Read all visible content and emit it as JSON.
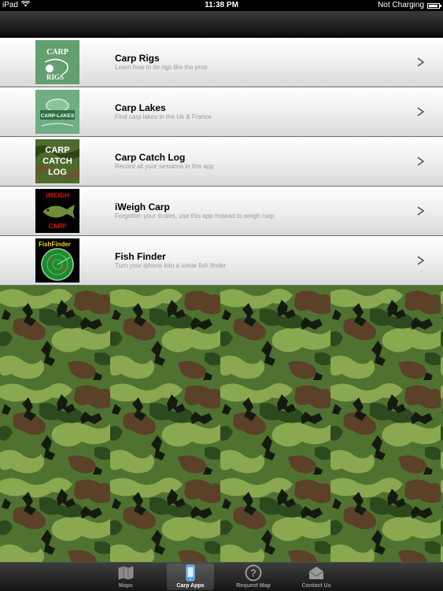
{
  "status_bar": {
    "device": "iPad",
    "time": "11:38 PM",
    "battery_status": "Not Charging",
    "battery_level": 0.9
  },
  "items": [
    {
      "title": "Carp Rigs",
      "subtitle": "Learn how to tie rigs like the pros",
      "thumb_lines": [
        "CARP",
        "RIGS"
      ]
    },
    {
      "title": "Carp Lakes",
      "subtitle": "Find carp lakes in the Uk & France",
      "thumb_lines": [
        "CARP-LAKES"
      ]
    },
    {
      "title": "Carp Catch Log",
      "subtitle": "Record all your sessions in this app",
      "thumb_lines": [
        "CARP",
        "CATCH",
        "LOG"
      ]
    },
    {
      "title": "iWeigh Carp",
      "subtitle": "Forgotten your scales, use this app instead to weigh carp",
      "thumb_lines": [
        "iWEIGH",
        "CARP"
      ]
    },
    {
      "title": "Fish Finder",
      "subtitle": "Turn your iphone into a sonar fish finder",
      "thumb_lines": [
        "FishFinder"
      ]
    }
  ],
  "tab_bar": {
    "tabs": [
      {
        "label": "Maps",
        "icon": "map-icon"
      },
      {
        "label": "Carp Apps",
        "icon": "phone-icon"
      },
      {
        "label": "Request Map",
        "icon": "question-icon"
      },
      {
        "label": "Contact Us",
        "icon": "envelope-icon"
      }
    ],
    "active_index": 1
  },
  "colors": {
    "camo_light": "#8aa850",
    "camo_mid": "#4f7230",
    "camo_dark": "#2d4a1e",
    "camo_brown": "#5a4128",
    "camo_black": "#151a10"
  }
}
